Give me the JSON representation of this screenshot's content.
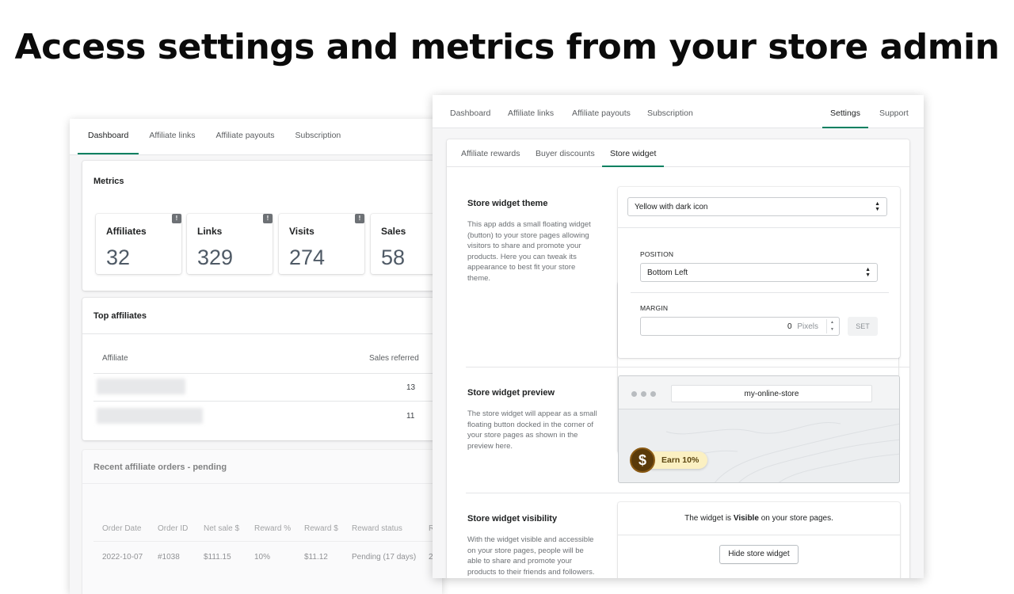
{
  "headline": "Access settings and metrics from your store admin",
  "dashboard": {
    "tabs": [
      "Dashboard",
      "Affiliate links",
      "Affiliate payouts",
      "Subscription"
    ],
    "metrics_title": "Metrics",
    "metrics": [
      {
        "label": "Affiliates",
        "value": "32"
      },
      {
        "label": "Links",
        "value": "329"
      },
      {
        "label": "Visits",
        "value": "274"
      },
      {
        "label": "Sales",
        "value": "58"
      }
    ],
    "top_affiliates": {
      "title": "Top affiliates",
      "col_affiliate": "Affiliate",
      "col_sales": "Sales referred",
      "rows": [
        {
          "sales": "13"
        },
        {
          "sales": "11"
        }
      ]
    },
    "recent_orders": {
      "title": "Recent affiliate orders - pending",
      "headers": [
        "Order Date",
        "Order ID",
        "Net sale $",
        "Reward %",
        "Reward $",
        "Reward status",
        "R"
      ],
      "row": [
        "2022-10-07",
        "#1038",
        "$111.15",
        "10%",
        "$11.12",
        "Pending (17 days)",
        "2"
      ]
    }
  },
  "settings": {
    "tabs": [
      "Dashboard",
      "Affiliate links",
      "Affiliate payouts",
      "Subscription",
      "Settings",
      "Support"
    ],
    "subtabs": [
      "Affiliate rewards",
      "Buyer discounts",
      "Store widget"
    ],
    "theme": {
      "title": "Store widget theme",
      "desc": "This app adds a small floating widget (button) to your store pages allowing visitors to share and promote your products. Here you can tweak its appearance to best fit your store theme.",
      "selected": "Yellow with dark icon",
      "position_label": "POSITION",
      "position_value": "Bottom Left",
      "margin_label": "MARGIN",
      "margin_value": "0",
      "margin_unit": "Pixels",
      "set_label": "SET"
    },
    "preview": {
      "title": "Store widget preview",
      "desc": "The store widget will appear as a small floating button docked in the corner of your store pages as shown in the preview here.",
      "url": "my-online-store",
      "coin": "$",
      "earn": "Earn 10%"
    },
    "visibility": {
      "title": "Store widget visibility",
      "desc": "With the widget visible and accessible on your store pages, people will be able to share and promote your products to their friends and followers.",
      "status_prefix": "The widget is",
      "status_value": "Visible",
      "status_suffix": "on your store pages.",
      "button": "Hide store widget"
    }
  }
}
